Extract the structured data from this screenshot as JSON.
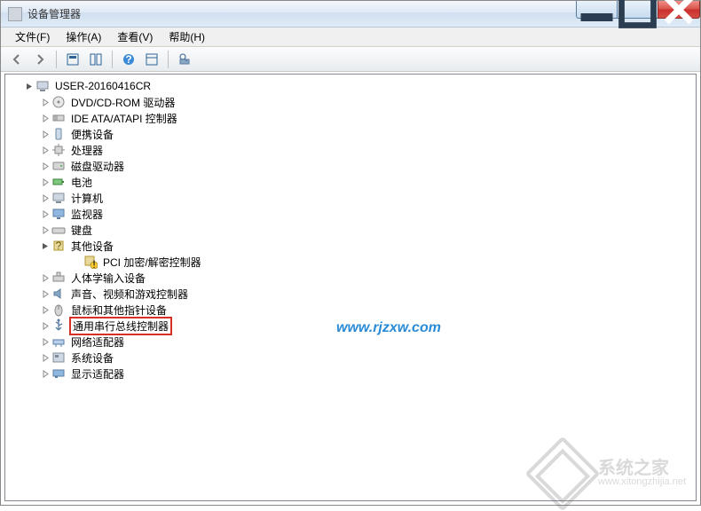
{
  "window": {
    "title": "设备管理器"
  },
  "menu": {
    "file": "文件(F)",
    "action": "操作(A)",
    "view": "查看(V)",
    "help": "帮助(H)"
  },
  "tree": {
    "root": "USER-20160416CR",
    "items": [
      {
        "label": "DVD/CD-ROM 驱动器"
      },
      {
        "label": "IDE ATA/ATAPI 控制器"
      },
      {
        "label": "便携设备"
      },
      {
        "label": "处理器"
      },
      {
        "label": "磁盘驱动器"
      },
      {
        "label": "电池"
      },
      {
        "label": "计算机"
      },
      {
        "label": "监视器"
      },
      {
        "label": "键盘"
      },
      {
        "label": "其他设备",
        "expanded": true,
        "children": [
          {
            "label": "PCI 加密/解密控制器"
          }
        ]
      },
      {
        "label": "人体学输入设备"
      },
      {
        "label": "声音、视频和游戏控制器"
      },
      {
        "label": "鼠标和其他指针设备"
      },
      {
        "label": "通用串行总线控制器",
        "highlight": true
      },
      {
        "label": "网络适配器"
      },
      {
        "label": "系统设备"
      },
      {
        "label": "显示适配器"
      }
    ]
  },
  "watermark": {
    "url": "www.rjzxw.com",
    "brand": "系统之家",
    "site": "www.xitongzhijia.net"
  }
}
